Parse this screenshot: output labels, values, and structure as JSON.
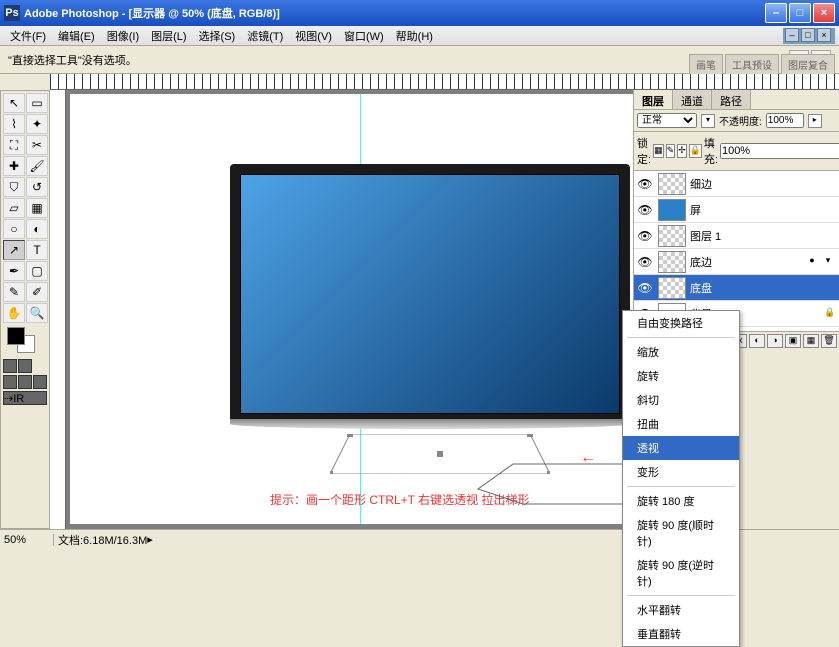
{
  "titlebar": {
    "app": "Adobe Photoshop",
    "doc": "[显示器 @ 50% (底盘, RGB/8)]"
  },
  "winbtns": {
    "min": "–",
    "max": "□",
    "close": "×"
  },
  "menu": [
    "文件(F)",
    "编辑(E)",
    "图像(I)",
    "图层(L)",
    "选择(S)",
    "滤镜(T)",
    "视图(V)",
    "窗口(W)",
    "帮助(H)"
  ],
  "docbtns": {
    "min": "–",
    "restore": "□",
    "close": "×"
  },
  "optbar": {
    "info": "\"直接选择工具\"没有选项。"
  },
  "paletteTabs": [
    "画笔",
    "工具预设",
    "图层复合"
  ],
  "panel": {
    "tabs": [
      "图层",
      "通道",
      "路径"
    ],
    "blend": "正常",
    "opacityLabel": "不透明度:",
    "opacity": "100%",
    "lockLabel": "锁定:",
    "fillLabel": "填充:",
    "fill": "100%"
  },
  "layers": [
    {
      "name": "细边",
      "thumb": "checker"
    },
    {
      "name": "屏",
      "thumb": "blue"
    },
    {
      "name": "图层 1",
      "thumb": "checker"
    },
    {
      "name": "底边",
      "thumb": "checker",
      "extras": true
    },
    {
      "name": "底盘",
      "thumb": "checker",
      "sel": true
    },
    {
      "name": "背景",
      "thumb": "white",
      "locked": true
    }
  ],
  "ctx": {
    "title": "自由变换路径",
    "items1": [
      "缩放",
      "旋转",
      "斜切",
      "扭曲",
      "透视",
      "变形"
    ],
    "hl": "透视",
    "items2": [
      "旋转 180 度",
      "旋转 90 度(顺时针)",
      "旋转 90 度(逆时针)"
    ],
    "items3": [
      "水平翻转",
      "垂直翻转"
    ]
  },
  "hint": "提示：画一个距形 CTRL+T 右键选透视 拉出梯形",
  "arrow": "←",
  "status": {
    "zoom": "50%",
    "doc": "文档:6.18M/16.3M"
  }
}
